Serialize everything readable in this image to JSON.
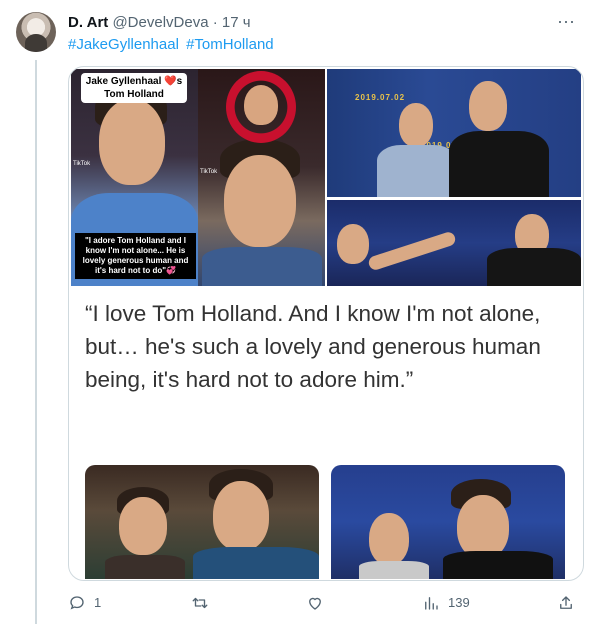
{
  "tweet": {
    "author_name": "D. Art",
    "handle": "@DevelvDeva",
    "separator": "·",
    "time": "17 ч",
    "more_glyph": "···",
    "hashtags": [
      "#JakeGyllenhaal",
      "#TomHolland"
    ]
  },
  "media": {
    "caption_top_name": "Jake Gyllenhaal",
    "caption_top_heart": "❤️",
    "caption_top_suffix": "s",
    "caption_top_line2": "Tom Holland",
    "caption_bottom": "\"I adore Tom Holland and I know I'm not alone... He is lovely generous human and it's hard not to do\"💞",
    "tiktok_label": "TikTok",
    "banner_text_1": "2019.07.02",
    "banner_text_2": "2019.07",
    "quote": "“I love Tom Holland. And I know I'm not alone, but… he's such a lovely and generous human being, it's hard not to adore him.”"
  },
  "actions": {
    "reply_count": "1",
    "retweet_count": "",
    "like_count": "",
    "views_count": "139"
  },
  "colors": {
    "link": "#1d9bf0",
    "muted": "#536471",
    "border": "#cfd9de"
  }
}
